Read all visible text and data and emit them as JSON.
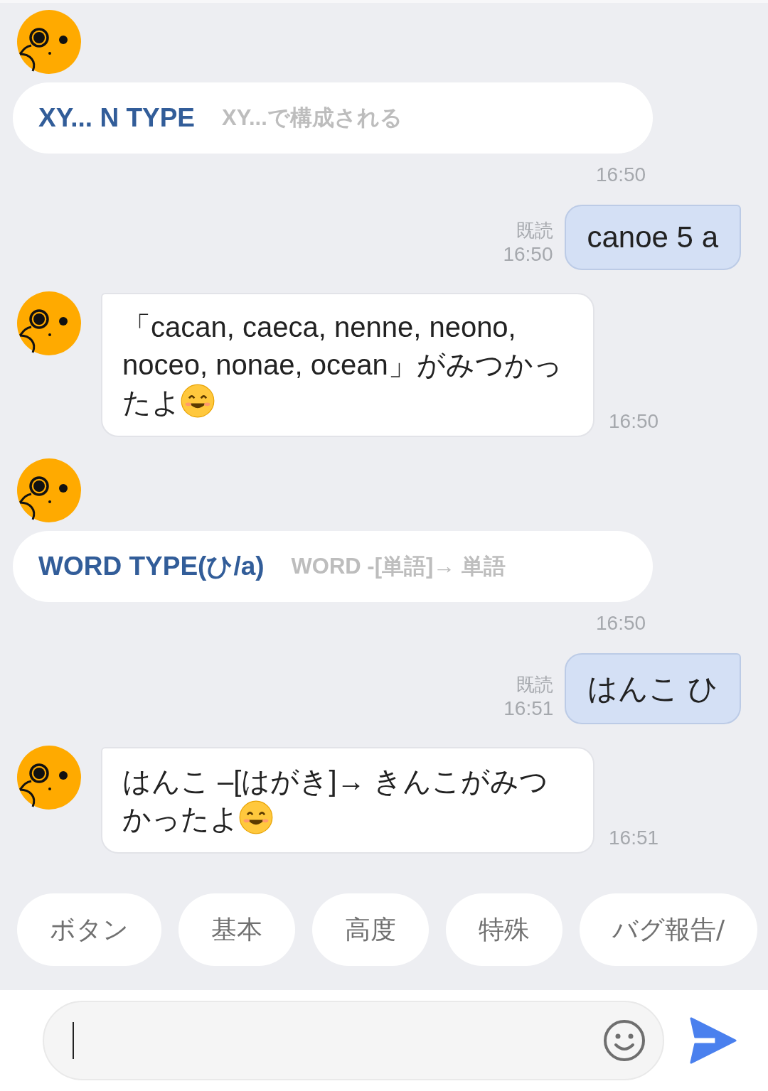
{
  "messages": [
    {
      "kind": "card",
      "title": "XY... N TYPE",
      "subtitle": "XY...で構成される",
      "time": "16:50"
    },
    {
      "kind": "sent",
      "read": "既読",
      "time": "16:50",
      "text": "canoe 5 a"
    },
    {
      "kind": "received",
      "text": "「cacan, caeca, nenne, neono, noceo, nonae, ocean」がみつかったよ",
      "emoji": true,
      "time": "16:50"
    },
    {
      "kind": "card",
      "title": "WORD TYPE(ひ/a)",
      "subtitle": "WORD -[単語]→ 単語",
      "time": "16:50"
    },
    {
      "kind": "sent",
      "read": "既読",
      "time": "16:51",
      "text": "はんこ ひ"
    },
    {
      "kind": "received",
      "text": "はんこ –[はがき]→ きんこがみつかったよ",
      "emoji": true,
      "time": "16:51"
    }
  ],
  "quick_replies": [
    "ボタン",
    "基本",
    "高度",
    "特殊",
    "バグ報告/"
  ]
}
